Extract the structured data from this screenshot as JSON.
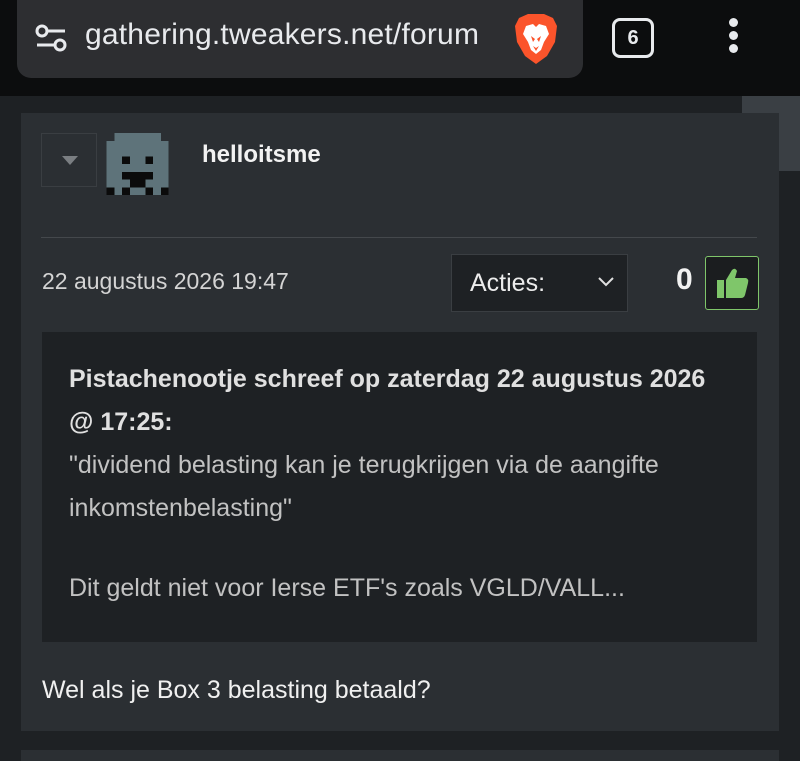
{
  "browser": {
    "url": "gathering.tweakers.net/forum",
    "tab_count": "6"
  },
  "post": {
    "username": "helloitsme",
    "date": "22 augustus 2026 19:47",
    "actions_label": "Acties:",
    "score": "0",
    "quote": {
      "header_line1": "Pistachenootje schreef op zaterdag 22 augustus 2026",
      "header_line2": "@ 17:25:",
      "body_line1": "\"dividend belasting kan je terugkrijgen via de aangifte",
      "body_line2": "inkomstenbelasting\"",
      "body_line3": "Dit geldt niet voor Ierse ETF's zoals VGLD/VALL..."
    },
    "reply": "Wel als je Box 3 belasting betaald?"
  },
  "colors": {
    "accent_green": "#7fc66a",
    "brave_orange": "#fb542b",
    "card_bg": "#2b2f33",
    "quote_bg": "#1e2124"
  },
  "icons": [
    "site-settings-icon",
    "brave-lion-icon",
    "tab-count-icon",
    "menu-icon",
    "collapse-icon",
    "chevron-down-icon",
    "thumbs-up-icon",
    "chevron-left-icon"
  ]
}
